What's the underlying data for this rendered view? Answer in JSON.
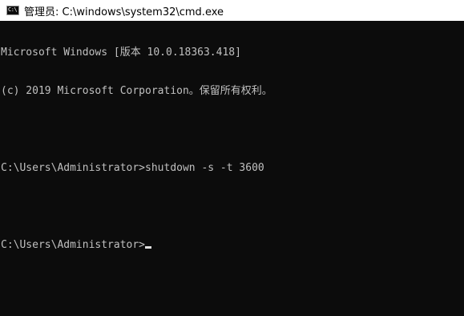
{
  "window": {
    "title": "管理员: C:\\windows\\system32\\cmd.exe",
    "icon": "cmd-console-icon",
    "icon_glyph": "C:\\"
  },
  "console": {
    "lines": [
      "Microsoft Windows [版本 10.0.18363.418]",
      "(c) 2019 Microsoft Corporation。保留所有权利。",
      "",
      "C:\\Users\\Administrator>shutdown -s -t 3600",
      "",
      "C:\\Users\\Administrator>"
    ]
  },
  "colors": {
    "background": "#0c0c0c",
    "text": "#c0c0c0",
    "titlebar": "#ffffff",
    "title_text": "#000000"
  }
}
